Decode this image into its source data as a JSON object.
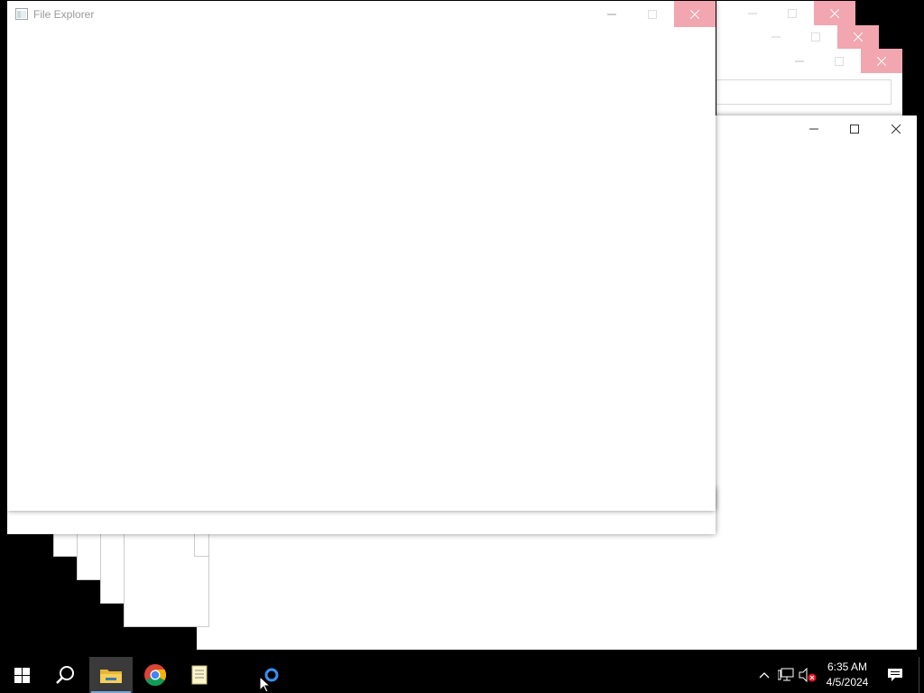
{
  "windows": {
    "main": {
      "title": "File Explorer"
    }
  },
  "taskbar": {
    "apps": [
      {
        "name": "Start"
      },
      {
        "name": "Search"
      },
      {
        "name": "File Explorer"
      },
      {
        "name": "Google Chrome"
      },
      {
        "name": "Notepad"
      },
      {
        "name": "Cortana"
      }
    ],
    "clock": {
      "time": "6:35 AM",
      "date": "4/5/2024"
    }
  },
  "colors": {
    "desktop": "#000000",
    "close_hover": "#f1a6b0",
    "taskbar": "#000000"
  }
}
